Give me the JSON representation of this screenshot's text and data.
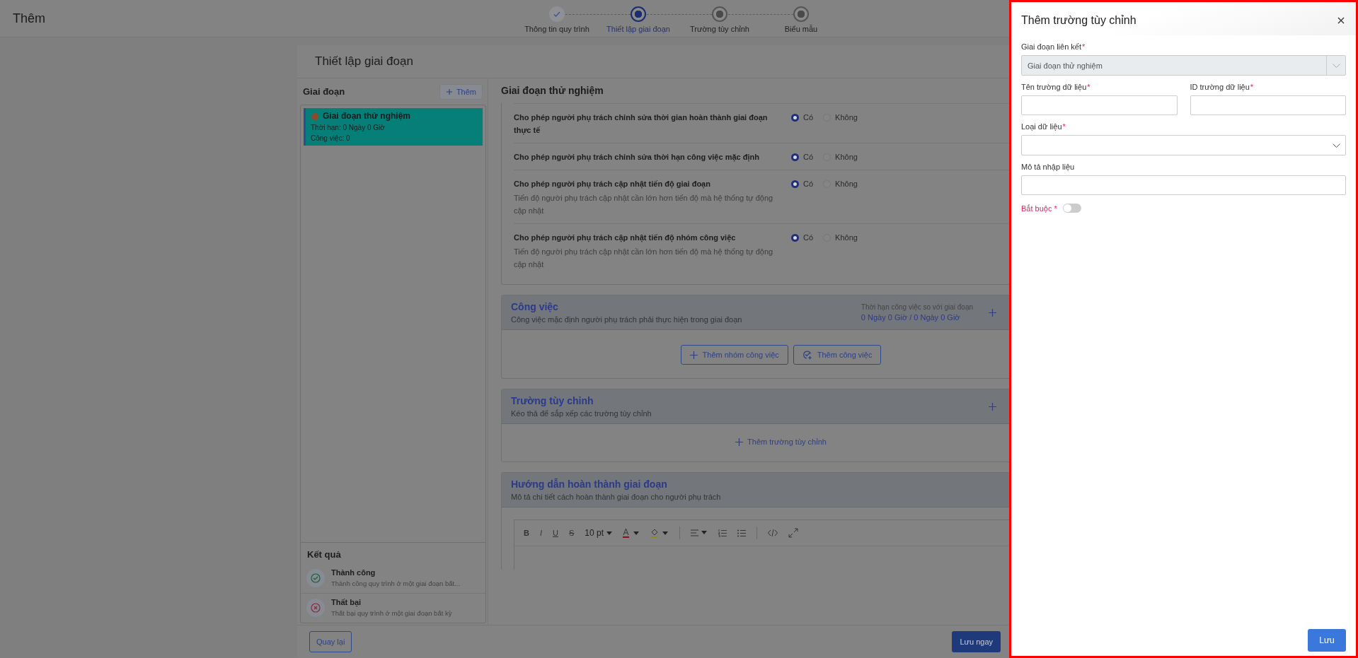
{
  "page_header": {
    "title": "Thêm"
  },
  "stepper": [
    {
      "label": "Thông tin quy trình",
      "kind": "done"
    },
    {
      "label": "Thiết lập giai đoạn",
      "kind": "current"
    },
    {
      "label": "Trường tùy chỉnh",
      "kind": "pending"
    },
    {
      "label": "Biểu mẫu",
      "kind": "pending"
    }
  ],
  "card": {
    "title": "Thiết lập giai đoạn"
  },
  "stages_panel": {
    "title": "Giai đoạn",
    "add_button": "Thêm",
    "items": [
      {
        "name": "Giai đoạn thử nghiệm",
        "duration": "Thời hạn: 0 Ngày 0 Giờ",
        "tasks": "Công việc: 0",
        "selected": true
      }
    ]
  },
  "results": {
    "title": "Kết quả",
    "items": [
      {
        "kind": "success",
        "title": "Thành công",
        "description": "Thành công quy trình ở một giai đoạn bất..."
      },
      {
        "kind": "failure",
        "title": "Thất bại",
        "description": "Thất bại quy trình ở một giai đoạn bất kỳ"
      }
    ]
  },
  "stage_settings": {
    "title": "Giai đoạn thử nghiệm",
    "options": [
      {
        "label": "Cho phép người phụ trách chỉnh sửa thời gian hoàn thành giai đoạn thực tế",
        "choices": [
          {
            "label": "Có",
            "selected": true
          },
          {
            "label": "Không",
            "selected": false
          }
        ]
      },
      {
        "label": "Cho phép người phụ trách chỉnh sửa thời hạn công việc mặc định",
        "choices": [
          {
            "label": "Có",
            "selected": true
          },
          {
            "label": "Không",
            "selected": false
          }
        ]
      },
      {
        "label": "Cho phép người phụ trách cập nhật tiến độ giai đoạn",
        "hint": "Tiến độ người phụ trách cập nhật cần lớn hơn tiến độ mà hệ thống tự động cập nhật",
        "choices": [
          {
            "label": "Có",
            "selected": true
          },
          {
            "label": "Không",
            "selected": false
          }
        ]
      },
      {
        "label": "Cho phép người phụ trách cập nhật tiến độ nhóm công việc",
        "hint": "Tiến độ người phụ trách cập nhật cần lớn hơn tiến độ mà hệ thống tự động cập nhật",
        "choices": [
          {
            "label": "Có",
            "selected": true
          },
          {
            "label": "Không",
            "selected": false
          }
        ]
      }
    ]
  },
  "tasks_section": {
    "title": "Công việc",
    "subtitle": "Công việc mặc định người phụ trách phải thực hiện trong giai đoạn",
    "deadline_label": "Thời hạn công việc so với giai đoạn",
    "deadline_value": "0 Ngày 0 Giờ / 0 Ngày 0 Giờ",
    "buttons": [
      {
        "kind": "group",
        "label": "Thêm nhóm công việc"
      },
      {
        "kind": "task",
        "label": "Thêm công việc"
      }
    ]
  },
  "custom_fields_section": {
    "title": "Trường tùy chỉnh",
    "subtitle": "Kéo thả để sắp xếp các trường tùy chỉnh",
    "add_link": "Thêm trường tùy chỉnh"
  },
  "guide_section": {
    "title": "Hướng dẫn hoàn thành giai đoạn",
    "subtitle": "Mô tả chi tiết cách hoàn thành giai đoạn cho người phụ trách",
    "format_buttons": [
      {
        "kind": "bold",
        "label": "B"
      },
      {
        "kind": "italic",
        "label": "I"
      },
      {
        "kind": "underline",
        "label": "U"
      },
      {
        "kind": "strike",
        "label": "S"
      }
    ],
    "font_size": "10 pt"
  },
  "footer": {
    "back": "Quay lại",
    "save": "Lưu ngay"
  },
  "drawer": {
    "title": "Thêm trường tùy chỉnh",
    "required_mark": "*",
    "rows": [
      [
        {
          "kind": "select",
          "label": "Giai đoạn liên kết",
          "required": true,
          "value": "Giai đoạn thử nghiệm",
          "disabled": true
        }
      ],
      [
        {
          "kind": "input",
          "label": "Tên trường dữ liệu",
          "required": true
        },
        {
          "kind": "input",
          "label": "ID trường dữ liệu",
          "required": true
        }
      ],
      [
        {
          "kind": "select",
          "label": "Loại dữ liệu",
          "required": true,
          "disabled": false
        }
      ],
      [
        {
          "kind": "input",
          "label": "Mô tả nhập liệu",
          "required": false
        }
      ]
    ],
    "toggle": {
      "label": "Bắt buộc *",
      "on": false
    },
    "save": "Lưu"
  }
}
